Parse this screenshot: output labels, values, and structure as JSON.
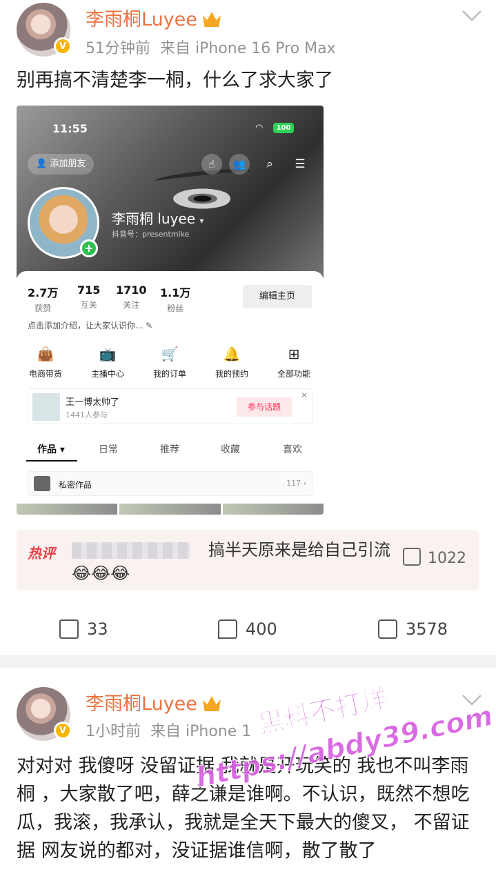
{
  "post1": {
    "username": "李雨桐Luyee",
    "time": "51分钟前",
    "source": "来自 iPhone 16 Pro Max",
    "text": "别再搞不清楚李一桐，什么了求大家了",
    "screenshot": {
      "status_time": "11:55",
      "battery": "100",
      "add_friend": "添加朋友",
      "profile_name": "李雨桐 luyee",
      "douyin_id": "抖音号：presentmike",
      "stats": [
        {
          "value": "2.7万",
          "label": "获赞"
        },
        {
          "value": "715",
          "label": "互关"
        },
        {
          "value": "1710",
          "label": "关注"
        },
        {
          "value": "1.1万",
          "label": "粉丝"
        }
      ],
      "edit_button": "编辑主页",
      "bio_placeholder": "点击添加介绍，让大家认识你...",
      "functions": [
        {
          "label": "电商带货",
          "icon": "bag-icon",
          "glyph": "👜"
        },
        {
          "label": "主播中心",
          "icon": "tv-icon",
          "glyph": "📺"
        },
        {
          "label": "我的订单",
          "icon": "cart-icon",
          "glyph": "🛒"
        },
        {
          "label": "我的预约",
          "icon": "bell-icon",
          "glyph": "🔔"
        },
        {
          "label": "全部功能",
          "icon": "grid-icon",
          "glyph": "⊞"
        }
      ],
      "topic_title": "王一博太帅了",
      "topic_sub": "1441人参与",
      "topic_button": "参与话题",
      "tabs": [
        "作品 ▾",
        "日常",
        "推荐",
        "收藏",
        "喜欢"
      ],
      "private_label": "私密作品",
      "private_count": "117 ›"
    },
    "hot_comment": {
      "tag": "热评",
      "text": "搞半天原来是给自己引流😂😂😂",
      "likes": "1022"
    },
    "actions": {
      "share": "33",
      "comments": "400",
      "likes": "3578"
    }
  },
  "post2": {
    "username": "李雨桐Luyee",
    "time": "1小时前",
    "source": "来自 iPhone 1",
    "text": "对对对 我傻呀 没留证据 我就是开玩笑的 我也不叫李雨桐 ，大家散了吧，薛之谦是谁啊。不认识，既然不想吃瓜，我滚，我承认，我就是全天下最大的傻叉， 不留证据 网友说的都对，没证据谁信啊，散了散了"
  },
  "watermark": {
    "line1": "黑料不打烊",
    "line2": "https://abdy39.com"
  }
}
